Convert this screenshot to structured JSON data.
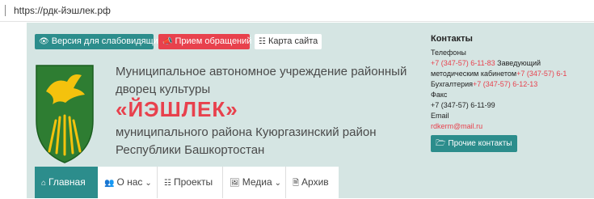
{
  "browser": {
    "url": "https://рдк-йэшлек.рф"
  },
  "top_buttons": {
    "vision": "Версия для слабовидящих",
    "appeal": "Прием обращений",
    "sitemap": "Карта сайта"
  },
  "org": {
    "line1": "Муниципальное автономное учреждение районный",
    "line2": "дворец культуры",
    "name": "«ЙЭШЛЕК»",
    "line3": "муниципального района Куюргазинский район",
    "line4": "Республики Башкортостан"
  },
  "contacts": {
    "title": "Контакты",
    "phones_label": "Телефоны",
    "phone1": "+7 (347-57) 6-11-83",
    "phone1_desc": "Заведующий",
    "phone2_desc": "методическим кабинетом",
    "phone2": "+7 (347-57) 6-1",
    "accounting_label": "Бухгалтерия",
    "accounting_phone": "+7 (347-57) 6-12-13",
    "fax_label": "Факс",
    "fax": "+7 (347-57) 6-11-99",
    "email_label": "Email",
    "email": "rdkerm@mail.ru",
    "more_button": "Прочие контакты"
  },
  "nav": {
    "home": "Главная",
    "about": "О нас",
    "projects": "Проекты",
    "media": "Медиа",
    "archive": "Архив"
  },
  "colors": {
    "teal": "#2c8d8c",
    "red": "#e8414d",
    "header_bg": "#d5e5e3"
  },
  "icons": [
    "eye-icon",
    "megaphone-icon",
    "sitemap-icon",
    "emblem-icon",
    "folder-icon",
    "home-icon",
    "people-icon",
    "chevron-down-icon",
    "diagram-icon",
    "images-icon",
    "document-icon"
  ]
}
